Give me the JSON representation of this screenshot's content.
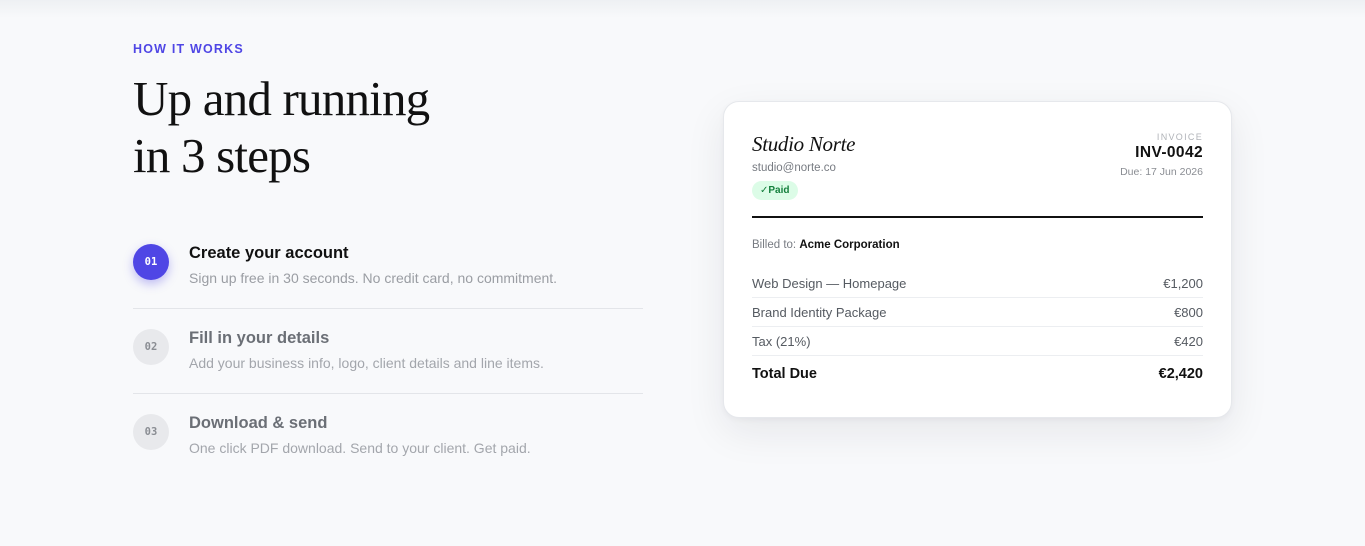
{
  "section": {
    "eyebrow": "HOW IT WORKS",
    "heading_line1": "Up and running",
    "heading_line2": "in 3 steps",
    "accent_color": "#4f46e5"
  },
  "steps": [
    {
      "number": "01",
      "title": "Create your account",
      "description": "Sign up free in 30 seconds. No credit card, no commitment.",
      "active": true
    },
    {
      "number": "02",
      "title": "Fill in your details",
      "description": "Add your business info, logo, client details and line items.",
      "active": false
    },
    {
      "number": "03",
      "title": "Download & send",
      "description": "One click PDF download. Send to your client. Get paid.",
      "active": false
    }
  ],
  "invoice": {
    "brand": "Studio Norte",
    "email": "studio@norte.co",
    "status": "✓Paid",
    "status_color": "#15803d",
    "label": "INVOICE",
    "number": "INV-0042",
    "due": "Due: 17 Jun 2026",
    "billed_to_label": "Billed to:",
    "billed_to": "Acme Corporation",
    "lines": [
      {
        "description": "Web Design — Homepage",
        "amount": "€1,200"
      },
      {
        "description": "Brand Identity Package",
        "amount": "€800"
      },
      {
        "description": "Tax (21%)",
        "amount": "€420"
      }
    ],
    "total_label": "Total Due",
    "total_amount": "€2,420"
  }
}
